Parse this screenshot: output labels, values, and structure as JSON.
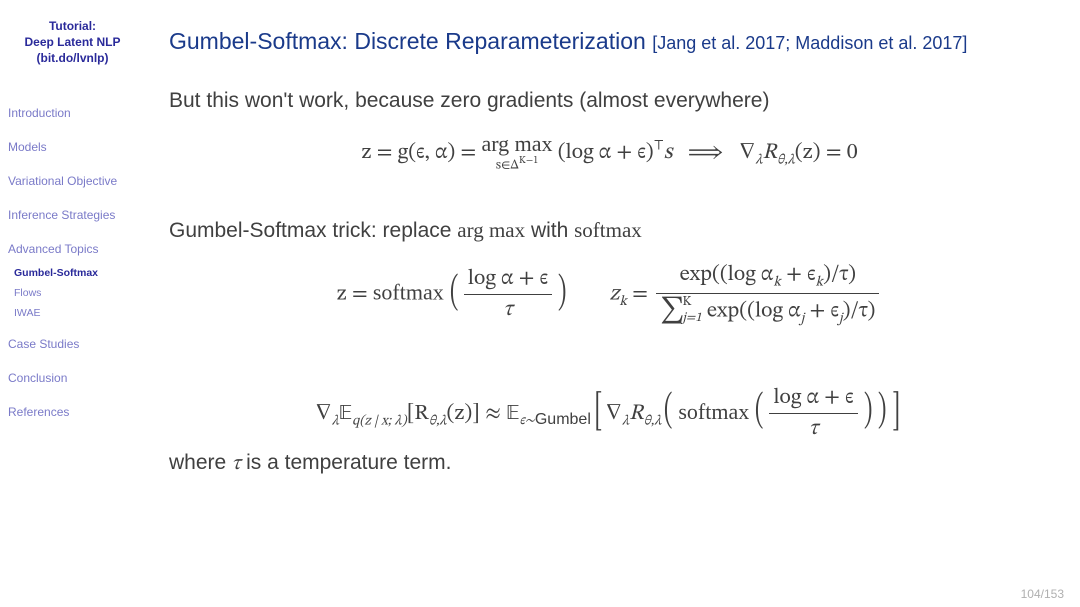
{
  "sidebar": {
    "title_line1": "Tutorial:",
    "title_line2": "Deep Latent NLP",
    "title_line3": "(bit.do/lvnlp)",
    "items": [
      {
        "label": "Introduction"
      },
      {
        "label": "Models"
      },
      {
        "label": "Variational Objective"
      },
      {
        "label": "Inference Strategies"
      },
      {
        "label": "Advanced Topics"
      },
      {
        "label": "Case Studies"
      },
      {
        "label": "Conclusion"
      },
      {
        "label": "References"
      }
    ],
    "subs": [
      {
        "label": "Gumbel-Softmax",
        "active": true
      },
      {
        "label": "Flows",
        "active": false
      },
      {
        "label": "IWAE",
        "active": false
      }
    ]
  },
  "title": {
    "main": "Gumbel-Softmax: Discrete Reparameterization",
    "cite": "[Jang et al. 2017; Maddison et al. 2017]"
  },
  "body": {
    "p1": "But this won't work, because zero gradients (almost everywhere)",
    "p2_a": "Gumbel-Softmax trick: replace ",
    "p2_b": " with ",
    "p3_a": "where ",
    "p3_b": " is a temperature term."
  },
  "math": {
    "argmax": "arg max",
    "softmax": "softmax",
    "tau": "τ",
    "eq1_lhs": "z = g(ϵ, α) = ",
    "eq1_argmax_sub": "s∈Δ",
    "eq1_K": "K−1",
    "eq1_body": "(log α + ϵ)",
    "eq1_top": "⊤",
    "eq1_s": "s",
    "eq1_implies": "⟹",
    "eq1_rhs": "∇",
    "eq1_lambda": "λ",
    "eq1_R": "R",
    "eq1_theta_lambda": "θ,λ",
    "eq1_z": "(z) = 0",
    "eq2a_lhs": "z = ",
    "eq2a_num": "log α + ϵ",
    "eq2a_den": "τ",
    "eq2b_lhs": "z",
    "eq2b_k": "k",
    "eq2b_eq": " = ",
    "eq2b_num_a": "exp((log α",
    "eq2b_num_b": " + ϵ",
    "eq2b_num_c": ")/τ)",
    "eq2b_den_sigma": "∑",
    "eq2b_den_sup": "K",
    "eq2b_den_sub": "j=1",
    "eq2b_den_a": " exp((log α",
    "eq2b_den_j": "j",
    "eq2b_den_b": " + ϵ",
    "eq2b_den_c": ")/τ)",
    "eq3_grad": "∇",
    "eq3_E": "𝔼",
    "eq3_q": "q(z | x; λ)",
    "eq3_Rz": "[R",
    "eq3_z2": "(z)] ≈ ",
    "eq3_gumbel": "ϵ∼Gumbel",
    "eq3_num": "log α + ϵ",
    "eq3_den": "τ"
  },
  "page": {
    "current": "104",
    "total": "153"
  }
}
